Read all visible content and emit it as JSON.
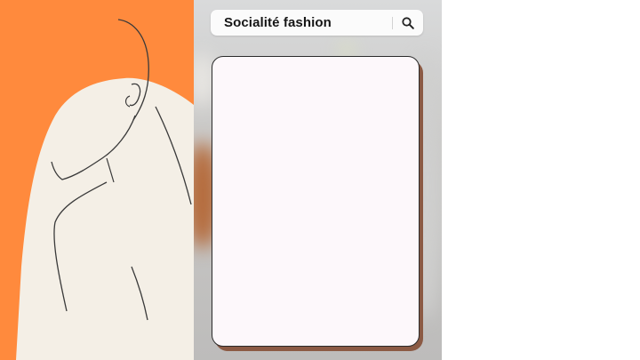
{
  "search": {
    "query": "Socialité fashion",
    "icon": "search-icon"
  },
  "colors": {
    "left_panel_bg": "#ff8a3d",
    "figure_fill": "#f4efe6",
    "card_bg": "#fdf8fb",
    "card_shadow": "#8b5a44"
  }
}
